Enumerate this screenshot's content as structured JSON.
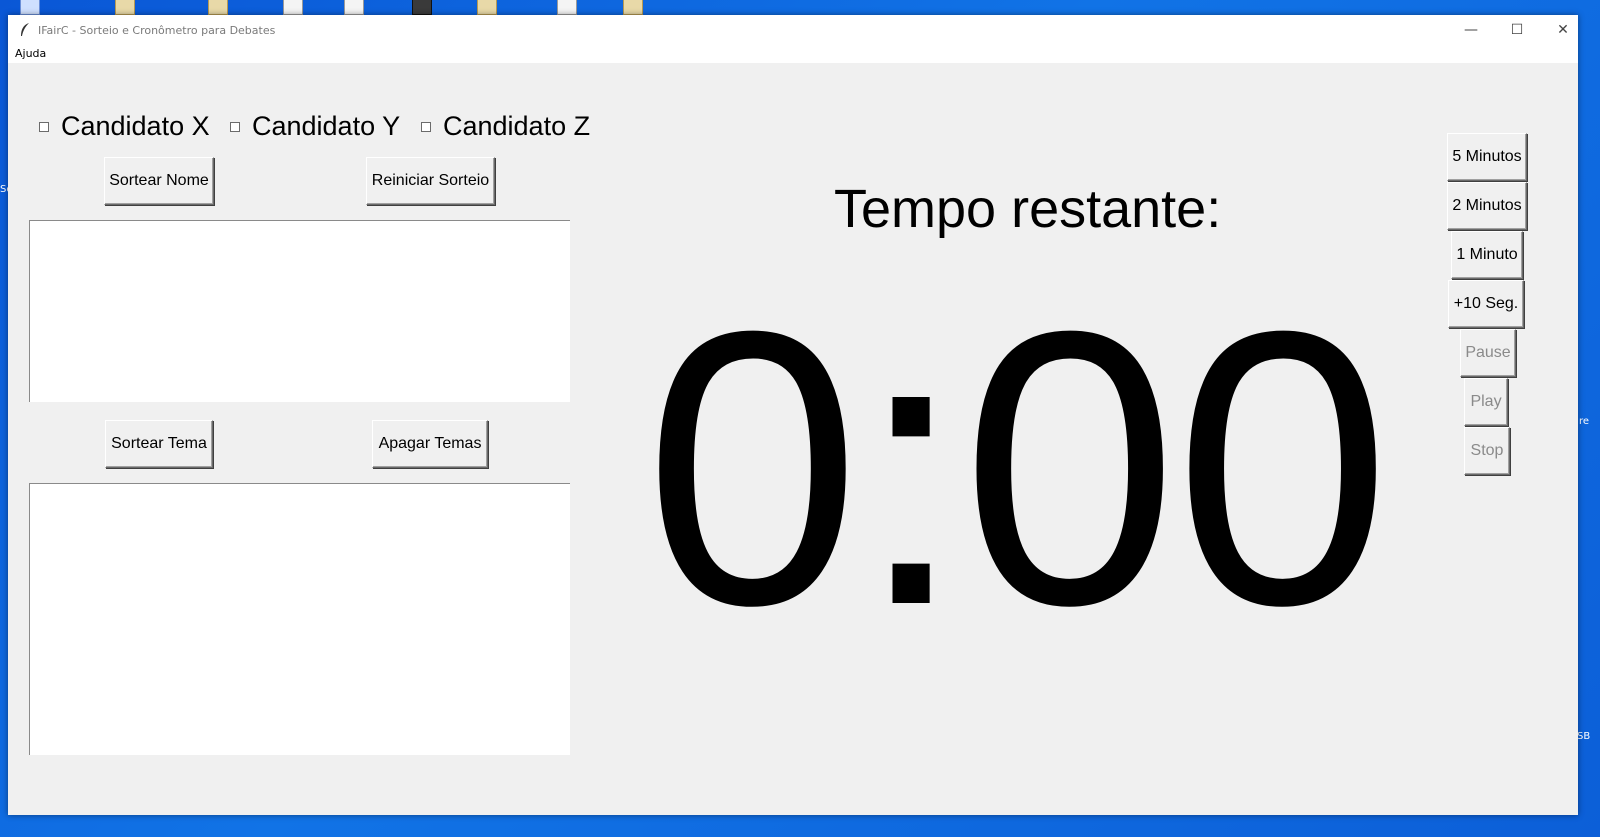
{
  "window": {
    "title": "IFairC - Sorteio e Cronômetro para Debates",
    "controls": {
      "minimize": "—",
      "maximize": "☐",
      "close": "✕"
    }
  },
  "menu": {
    "help": "Ajuda"
  },
  "candidates": [
    {
      "label": "Candidato X",
      "checked": false
    },
    {
      "label": "Candidato Y",
      "checked": false
    },
    {
      "label": "Candidato Z",
      "checked": false
    }
  ],
  "draw": {
    "sort_name": "Sortear Nome",
    "reset_draw": "Reiniciar Sorteio",
    "sort_theme": "Sortear Tema",
    "clear_themes": "Apagar Temas"
  },
  "timer": {
    "label": "Tempo restante:",
    "value": "0:00"
  },
  "time_buttons": {
    "five_min": "5 Minutos",
    "two_min": "2 Minutos",
    "one_min": "1 Minuto",
    "plus_ten": "+10 Seg.",
    "pause": "Pause",
    "play": "Play",
    "stop": "Stop"
  },
  "desktop": {
    "edge_text_1": "Sc",
    "edge_text_2": "re",
    "edge_text_3": "SB"
  }
}
